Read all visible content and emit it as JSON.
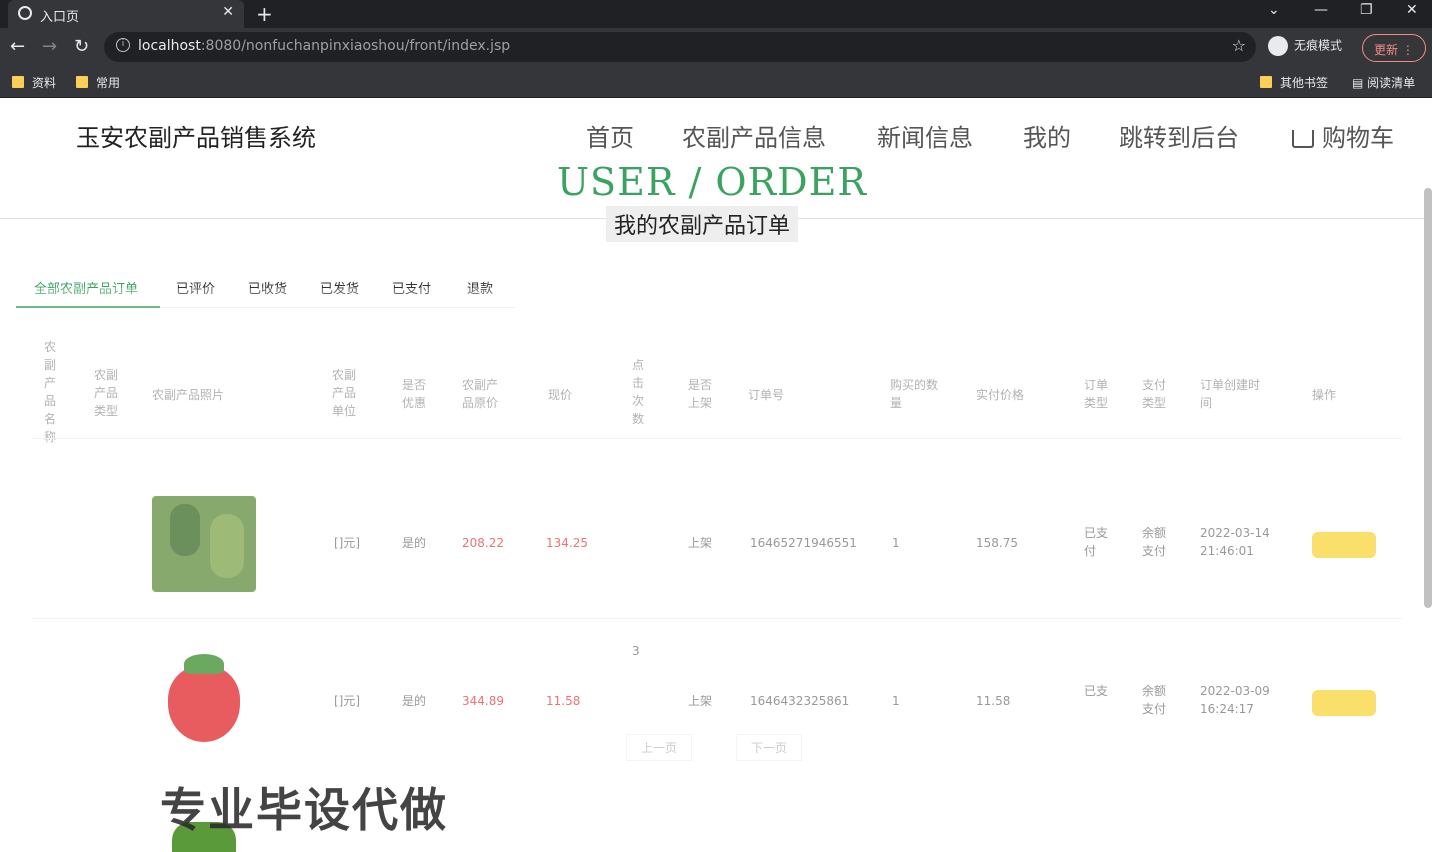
{
  "browser": {
    "tab_title": "入口页",
    "url_host": "localhost",
    "url_rest": ":8080/nonfuchanpinxiaoshou/front/index.jsp",
    "incognito_label": "无痕模式",
    "update_label": "更新",
    "bookmarks": [
      "资料",
      "常用"
    ],
    "bookmarks_right": [
      "其他书签",
      "阅读清单"
    ]
  },
  "site": {
    "title": "玉安农副产品销售系统",
    "nav": [
      "首页",
      "农副产品信息",
      "新闻信息",
      "我的",
      "跳转到后台",
      "购物车"
    ]
  },
  "hero": {
    "title_en": "USER / ORDER",
    "title_cn": "我的农副产品订单"
  },
  "tabs": [
    "全部农副产品订单",
    "已评价",
    "已收货",
    "已发货",
    "已支付",
    "退款"
  ],
  "table": {
    "headers": [
      "农\n副\n产\n品\n名\n称",
      "农副\n产品\n类型",
      "农副产品照片",
      "农副\n产品\n单位",
      "是否\n优惠",
      "农副产\n品原价",
      "现价",
      "点\n击\n次\n数",
      "是否\n上架",
      "订单号",
      "购买的数\n量",
      "实付价格",
      "订单\n类型",
      "支付\n类型",
      "订单创建时\n间",
      "操作"
    ],
    "rows": [
      {
        "unit": "[]元]",
        "discount": "是的",
        "orig_price": "208.22",
        "price": "134.25",
        "status": "上架",
        "order_no": "16465271946551",
        "qty": "1",
        "paid": "158.75",
        "type": "已支\n付",
        "pay": "余额\n支付",
        "created": "2022-03-14\n21:46:01"
      },
      {
        "unit": "[]元]",
        "discount": "是的",
        "orig_price": "344.89",
        "price": "11.58",
        "clicks": "3",
        "status": "上架",
        "order_no": "1646432325861",
        "qty": "1",
        "paid": "11.58",
        "type": "已支",
        "pay": "余额\n支付",
        "created": "2022-03-09\n16:24:17"
      }
    ]
  },
  "pager": {
    "prev": "上一页",
    "next": "下一页"
  },
  "watermark": "专业毕设代做",
  "colors": {
    "accent": "#3aa35f",
    "price": "#e64545",
    "button": "#f6d63a"
  }
}
